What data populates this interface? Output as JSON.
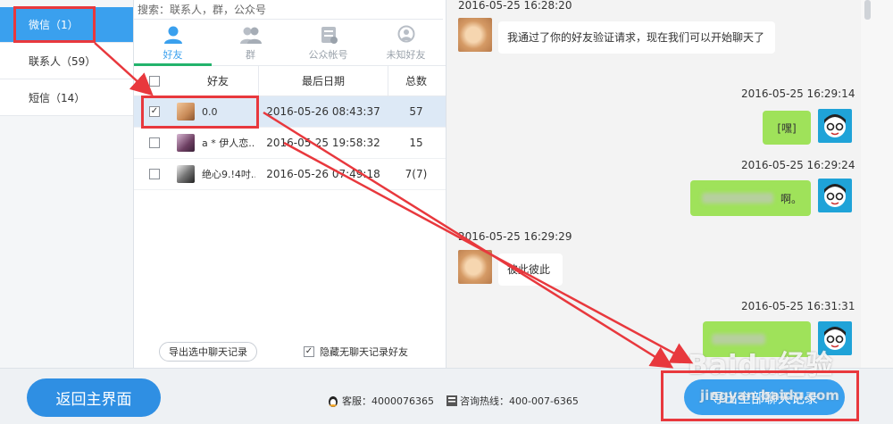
{
  "nav": {
    "items": [
      {
        "label": "微信（1）",
        "active": true
      },
      {
        "label": "联系人（59）",
        "active": false
      },
      {
        "label": "短信（14）",
        "active": false
      }
    ]
  },
  "search": {
    "placeholder": "搜索：联系人，群，公众号"
  },
  "tabs": [
    {
      "label": "好友",
      "icon": "person-icon",
      "active": true
    },
    {
      "label": "群",
      "icon": "group-icon",
      "active": false
    },
    {
      "label": "公众帐号",
      "icon": "official-account-icon",
      "active": false
    },
    {
      "label": "未知好友",
      "icon": "unknown-friend-icon",
      "active": false
    }
  ],
  "table": {
    "headers": {
      "friend": "好友",
      "date": "最后日期",
      "total": "总数"
    },
    "rows": [
      {
        "name": "0.0",
        "date": "2016-05-26 08:43:37",
        "total": "57",
        "checked": true
      },
      {
        "name": "a * 伊人恋...",
        "date": "2016-05-25 19:58:32",
        "total": "15",
        "checked": false
      },
      {
        "name": "绝心9.!4吋...",
        "date": "2016-05-26 07:49:18",
        "total": "7(7)",
        "checked": false
      }
    ]
  },
  "mid_footer": {
    "export_selected": "导出选中聊天记录",
    "hide_label": "隐藏无聊天记录好友",
    "hide_checked": true
  },
  "chat": {
    "messages": [
      {
        "time": "2016-05-25 16:28:20",
        "dir": "in",
        "text": "我通过了你的好友验证请求，现在我们可以开始聊天了"
      },
      {
        "time": "2016-05-25 16:29:14",
        "dir": "out",
        "text": "[嘿]"
      },
      {
        "time": "2016-05-25 16:29:24",
        "dir": "out",
        "text": "啊。"
      },
      {
        "time": "2016-05-25 16:29:29",
        "dir": "in",
        "text": "彼此彼此"
      },
      {
        "time": "2016-05-25 16:31:31",
        "dir": "out",
        "text": ""
      }
    ]
  },
  "bottom": {
    "back_button": "返回主界面",
    "service": "客服：4000076365",
    "hotline": "咨询热线：400-007-6365",
    "export_all": "导出全部聊天记录"
  },
  "watermark": {
    "logo": "Baidu经验",
    "url": "jingyan.baidu.com"
  },
  "colors": {
    "accent": "#3aa0ee",
    "bubble_out": "#9fe25a",
    "annotation": "#e8383d",
    "tab_underline": "#22b36c"
  }
}
